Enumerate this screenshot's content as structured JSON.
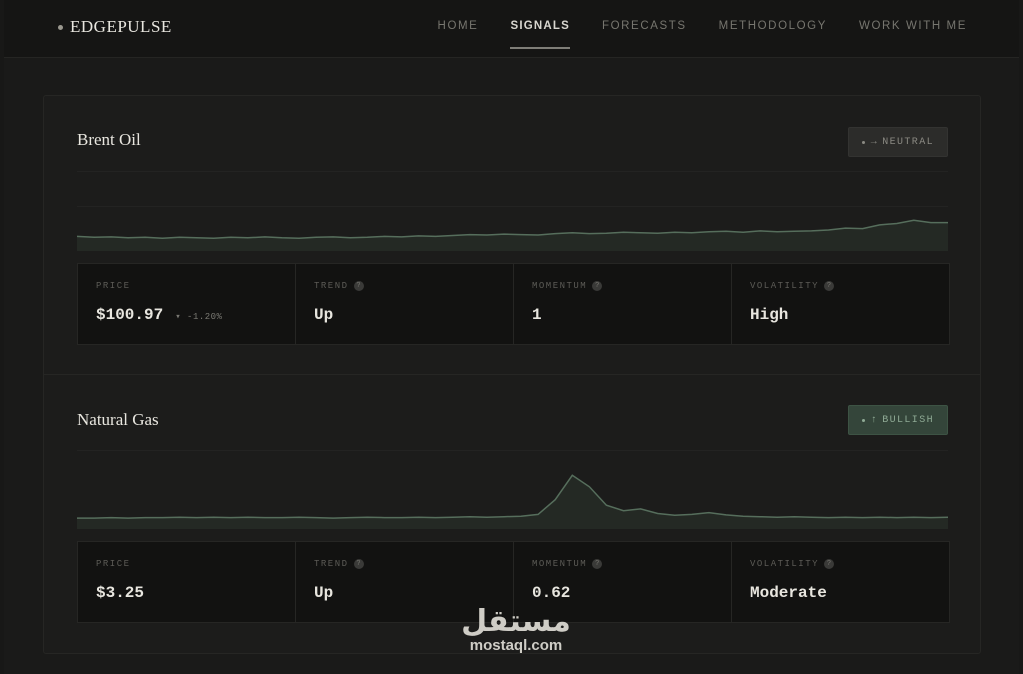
{
  "brand": {
    "name": "EDGEPULSE"
  },
  "nav": {
    "items": [
      {
        "label": "HOME",
        "active": false
      },
      {
        "label": "SIGNALS",
        "active": true
      },
      {
        "label": "FORECASTS",
        "active": false
      },
      {
        "label": "METHODOLOGY",
        "active": false
      },
      {
        "label": "WORK WITH ME",
        "active": false
      }
    ]
  },
  "signals": [
    {
      "name": "Brent Oil",
      "badge": {
        "arrow": "→",
        "label": "NEUTRAL",
        "style": "neutral"
      },
      "metrics": {
        "price_label": "PRICE",
        "price": "$100.97",
        "change": "▾ -1.20%",
        "trend_label": "TREND",
        "trend": "Up",
        "momentum_label": "MOMENTUM",
        "momentum": "1",
        "volatility_label": "VOLATILITY",
        "volatility": "High"
      },
      "sparkline": [
        0.1,
        0.08,
        0.09,
        0.07,
        0.08,
        0.06,
        0.08,
        0.07,
        0.06,
        0.08,
        0.07,
        0.09,
        0.07,
        0.06,
        0.08,
        0.09,
        0.07,
        0.08,
        0.1,
        0.09,
        0.11,
        0.1,
        0.12,
        0.14,
        0.13,
        0.15,
        0.14,
        0.13,
        0.16,
        0.18,
        0.16,
        0.17,
        0.19,
        0.18,
        0.17,
        0.19,
        0.18,
        0.2,
        0.21,
        0.19,
        0.22,
        0.2,
        0.21,
        0.22,
        0.24,
        0.28,
        0.27,
        0.35,
        0.38,
        0.45,
        0.4,
        0.4
      ]
    },
    {
      "name": "Natural Gas",
      "badge": {
        "arrow": "↑",
        "label": "BULLISH",
        "style": "bullish"
      },
      "metrics": {
        "price_label": "PRICE",
        "price": "$3.25",
        "change": "",
        "trend_label": "TREND",
        "trend": "Up",
        "momentum_label": "MOMENTUM",
        "momentum": "0.62",
        "volatility_label": "VOLATILITY",
        "volatility": "Moderate"
      },
      "sparkline": [
        0.02,
        0.02,
        0.03,
        0.02,
        0.03,
        0.03,
        0.04,
        0.03,
        0.04,
        0.03,
        0.04,
        0.03,
        0.03,
        0.04,
        0.03,
        0.02,
        0.03,
        0.04,
        0.03,
        0.03,
        0.04,
        0.03,
        0.04,
        0.05,
        0.04,
        0.05,
        0.06,
        0.1,
        0.42,
        0.95,
        0.7,
        0.3,
        0.18,
        0.22,
        0.12,
        0.08,
        0.1,
        0.14,
        0.09,
        0.06,
        0.05,
        0.04,
        0.05,
        0.04,
        0.03,
        0.04,
        0.03,
        0.04,
        0.03,
        0.04,
        0.03,
        0.04
      ]
    }
  ],
  "watermark": {
    "arabic": "مستقل",
    "latin": "mostaql.com"
  },
  "colors": {
    "line": "#566e5c",
    "fill": "#2a322c"
  }
}
